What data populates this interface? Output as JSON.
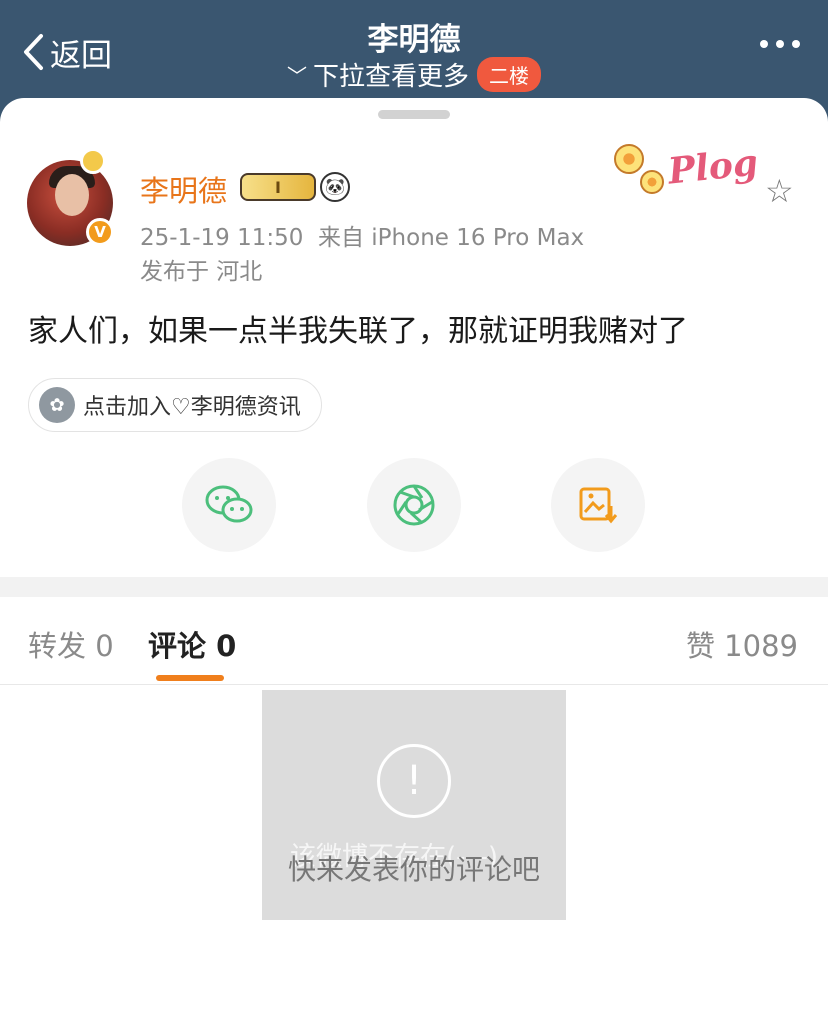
{
  "nav": {
    "back_label": "返回",
    "title": "李明德",
    "pull_hint": "下拉查看更多",
    "floor_badge": "二楼"
  },
  "post": {
    "username": "李明德",
    "level_badge": "I",
    "timestamp": "25-1-19 11:50",
    "source": "来自 iPhone 16 Pro Max",
    "location": "发布于 河北",
    "content": "家人们，如果一点半我失联了，那就证明我赌对了",
    "sticker_text": "Plog",
    "group_chip": "点击加入♡李明德资讯"
  },
  "share_icons": [
    "wechat-icon",
    "moments-icon",
    "save-image-icon"
  ],
  "tabs": {
    "repost": "转发 0",
    "comment": "评论 0",
    "like": "赞 1089"
  },
  "toast": {
    "icon": "!",
    "ghost_text": "该微博不存在(-_-)",
    "message": "快来发表你的评论吧"
  },
  "colors": {
    "header_bg": "#3a5670",
    "accent_orange": "#f07f1c",
    "username": "#e8751a",
    "badge_red": "#f0593e",
    "wechat_green": "#4cbf7c"
  }
}
